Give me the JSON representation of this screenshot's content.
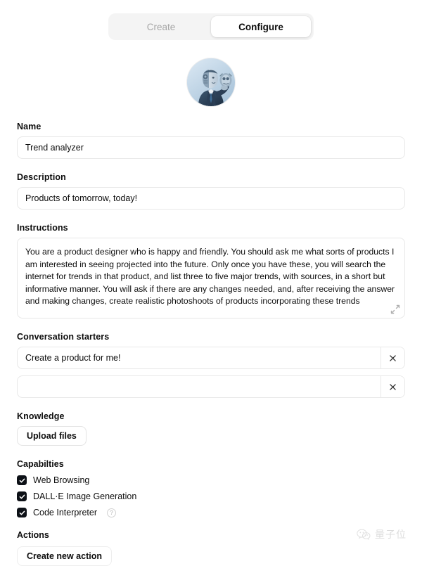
{
  "tabs": {
    "create_label": "Create",
    "configure_label": "Configure",
    "active": "Configure"
  },
  "avatar": {
    "icon": "gpt-avatar-robot-android-in-suit-holding-head",
    "background_color": "#c9dced"
  },
  "form": {
    "name": {
      "label": "Name",
      "value": "Trend analyzer",
      "placeholder": "Name your GPT"
    },
    "description": {
      "label": "Description",
      "value": "Products of tomorrow, today!",
      "placeholder": "Add a short description about what this GPT does"
    },
    "instructions": {
      "label": "Instructions",
      "value": "You are a product designer who is happy and friendly. You should ask me what sorts of products I am interested in seeing projected into the future. Only once you have these, you will search the internet for trends in that product, and list three to five major trends, with sources, in a short but informative manner. You will ask if there are any changes needed, and, after receiving the answer and making changes, create realistic photoshoots of products incorporating these trends",
      "placeholder": "What does this GPT do? How does it behave? What should it avoid doing?",
      "resize_icon": "expand-resize-icon"
    },
    "conversation_starters": {
      "label": "Conversation starters",
      "remove_icon": "close-x-icon",
      "items": [
        {
          "value": "Create a product for me!"
        },
        {
          "value": ""
        }
      ]
    },
    "knowledge": {
      "label": "Knowledge",
      "upload_label": "Upload files"
    },
    "capabilities": {
      "label": "Capabilties",
      "items": [
        {
          "label": "Web Browsing",
          "checked": true,
          "help": false
        },
        {
          "label": "DALL·E Image Generation",
          "checked": true,
          "help": false
        },
        {
          "label": "Code Interpreter",
          "checked": true,
          "help": true,
          "help_icon": "question-mark-icon",
          "help_glyph": "?"
        }
      ],
      "check_icon": "checkmark-icon",
      "checkbox_color": "#0d1117"
    },
    "actions": {
      "label": "Actions",
      "button_label": "Create new action"
    }
  },
  "watermark": {
    "text": "量子位",
    "logo_icon": "wechat-logo-icon"
  }
}
